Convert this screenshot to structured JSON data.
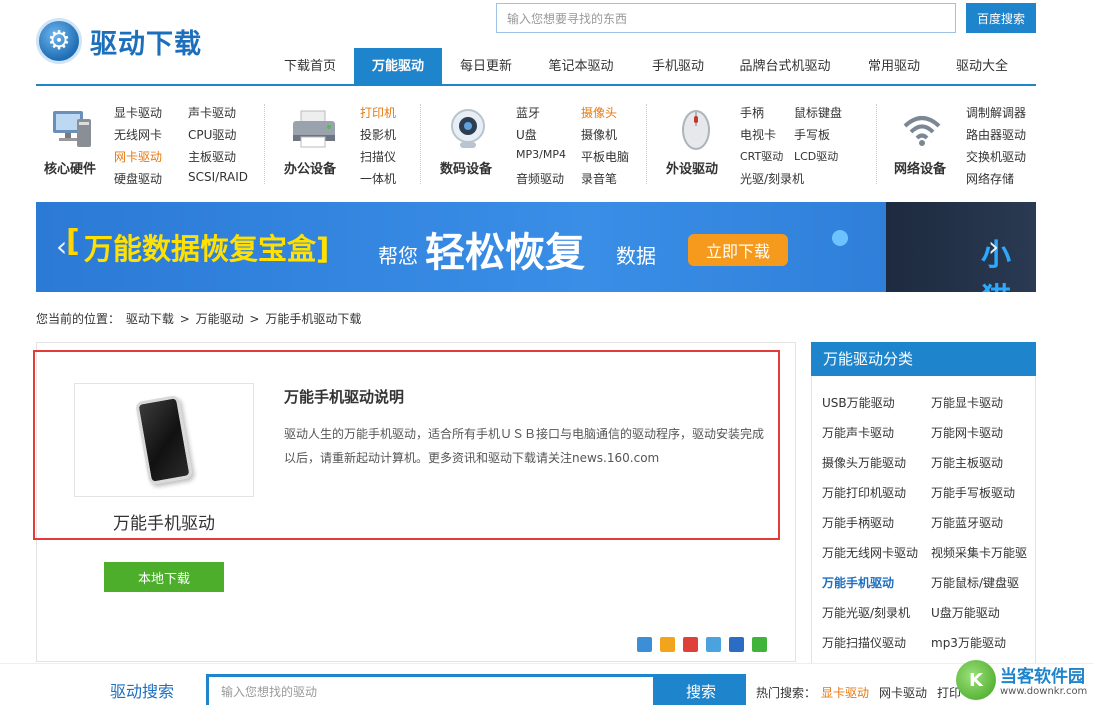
{
  "header": {
    "logo_text": "驱动下载",
    "search_placeholder": "输入您想要寻找的东西",
    "search_button": "百度搜索"
  },
  "nav": {
    "items": [
      "下载首页",
      "万能驱动",
      "每日更新",
      "笔记本驱动",
      "手机驱动",
      "品牌台式机驱动",
      "常用驱动",
      "驱动大全"
    ],
    "active_index": 1
  },
  "categories": [
    {
      "name": "核心硬件",
      "icon": "computer-icon",
      "links": [
        "显卡驱动",
        "声卡驱动",
        "无线网卡",
        "CPU驱动",
        "网卡驱动",
        "主板驱动",
        "硬盘驱动",
        "SCSI/RAID"
      ]
    },
    {
      "name": "办公设备",
      "icon": "printer-icon",
      "links": [
        "打印机",
        "投影机",
        "扫描仪",
        "一体机"
      ]
    },
    {
      "name": "数码设备",
      "icon": "webcam-icon",
      "links": [
        "蓝牙",
        "摄像头",
        "U盘",
        "摄像机",
        "MP3/MP4",
        "平板电脑",
        "音频驱动",
        "录音笔"
      ]
    },
    {
      "name": "外设驱动",
      "icon": "mouse-icon",
      "links": [
        "手柄",
        "鼠标键盘",
        "电视卡",
        "手写板",
        "CRT驱动",
        "LCD驱动",
        "光驱/刻录机"
      ]
    },
    {
      "name": "网络设备",
      "icon": "wifi-icon",
      "links": [
        "调制解调器",
        "路由器驱动",
        "交换机驱动",
        "网络存储"
      ]
    }
  ],
  "banner": {
    "bracket_left": "[",
    "title": "万能数据恢复宝盒]",
    "text_small": "帮您",
    "text_big": "轻松恢复",
    "text_small2": "数据",
    "button": "立即下载",
    "right_text": "小猫"
  },
  "breadcrumb": {
    "label": "您当前的位置：",
    "items": [
      "驱动下载",
      "万能驱动",
      "万能手机驱动下载"
    ],
    "separator": ">"
  },
  "product": {
    "name": "万能手机驱动",
    "desc_title": "万能手机驱动说明",
    "desc_text": "驱动人生的万能手机驱动，适合所有手机ＵＳＢ接口与电脑通信的驱动程序，驱动安装完成以后，请重新起动计算机。更多资讯和驱动下载请关注news.160.com",
    "download_button": "本地下载"
  },
  "sidebar": {
    "title": "万能驱动分类",
    "links": [
      "USB万能驱动",
      "万能显卡驱动",
      "万能声卡驱动",
      "万能网卡驱动",
      "摄像头万能驱动",
      "万能主板驱动",
      "万能打印机驱动",
      "万能手写板驱动",
      "万能手柄驱动",
      "万能蓝牙驱动",
      "万能无线网卡驱动",
      "视频采集卡万能驱",
      "万能手机驱动",
      "万能鼠标/键盘驱",
      "万能光驱/刻录机",
      "U盘万能驱动",
      "万能扫描仪驱动",
      "mp3万能驱动"
    ],
    "active_index": 12
  },
  "bottom": {
    "label": "驱动搜索",
    "placeholder": "输入您想找的驱动",
    "button": "搜索",
    "hot_label": "热门搜索：",
    "hot_links": [
      "显卡驱动",
      "网卡驱动",
      "打印"
    ]
  },
  "watermark": {
    "title": "当客软件园",
    "url": "www.downkr.com",
    "badge": "K"
  },
  "colors": {
    "accent": "#1e84cc",
    "orange": "#e8790f",
    "green": "#4cae2a",
    "highlight_red": "#e33a3a"
  }
}
